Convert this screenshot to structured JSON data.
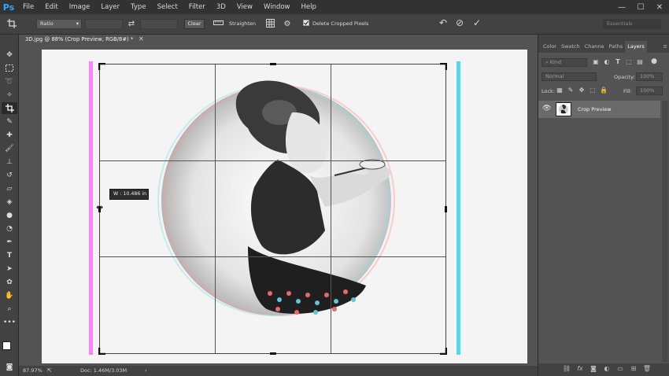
{
  "app": {
    "logo": "Ps"
  },
  "menu": [
    "File",
    "Edit",
    "Image",
    "Layer",
    "Type",
    "Select",
    "Filter",
    "3D",
    "View",
    "Window",
    "Help"
  ],
  "window_controls": {
    "minimize": "—",
    "maximize": "☐",
    "close": "✕"
  },
  "options_bar": {
    "ratio_value": "Ratio",
    "clear_label": "Clear",
    "straighten_label": "Straighten",
    "delete_cropped_label": "Delete Cropped Pixels",
    "delete_cropped_checked": true,
    "workspace": "Essentials"
  },
  "document": {
    "tab_title": "3D.jpg @ 88% (Crop Preview, RGB/8#) *",
    "zoom": "87.97%",
    "doc_info": "Doc: 1.46M/3.03M",
    "crop_tooltip_label": "W :",
    "crop_tooltip_value": "10.486 in"
  },
  "panels": {
    "tabs": [
      "Color",
      "Swatch",
      "Channe",
      "Paths",
      "Layers"
    ],
    "active_tab": "Layers",
    "kind_placeholder": "Kind",
    "blend_mode": "Normal",
    "opacity_label": "Opacity:",
    "opacity_value": "100%",
    "lock_label": "Lock:",
    "fill_label": "Fill:",
    "fill_value": "100%",
    "layers": [
      {
        "name": "Crop Preview",
        "visible": true
      }
    ]
  },
  "colors": {
    "accent_blue": "#31a8ff",
    "guide_magenta": "#ff80ff",
    "guide_cyan": "#55d8ec"
  }
}
